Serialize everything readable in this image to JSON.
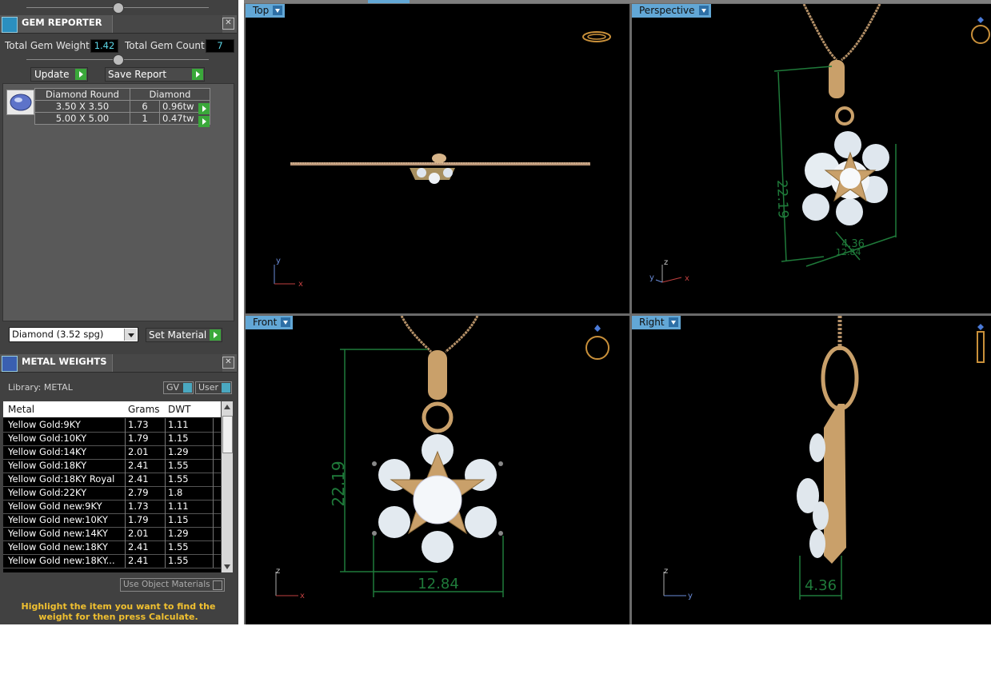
{
  "gem_reporter": {
    "title": "GEM REPORTER",
    "close": "✕",
    "total_weight_label": "Total Gem Weight",
    "total_weight_value": "1.42",
    "total_count_label": "Total Gem Count",
    "total_count_value": "7",
    "update_label": "Update",
    "save_report_label": "Save Report",
    "table": {
      "headers": [
        "Diamond Round",
        "Diamond"
      ],
      "rows": [
        {
          "size": "3.50 X 3.50",
          "count": "6",
          "weight": "0.96tw"
        },
        {
          "size": "5.00 X 5.00",
          "count": "1",
          "weight": "0.47tw"
        }
      ]
    },
    "material_select": "Diamond     (3.52 spg)",
    "set_material_label": "Set Material"
  },
  "metal_weights": {
    "title": "METAL WEIGHTS",
    "close": "✕",
    "library_label": "Library: METAL",
    "gv_label": "GV",
    "user_label": "User",
    "columns": [
      "Metal",
      "Grams",
      "DWT"
    ],
    "rows": [
      {
        "metal": "Yellow Gold:9KY",
        "grams": "1.73",
        "dwt": "1.11"
      },
      {
        "metal": "Yellow Gold:10KY",
        "grams": "1.79",
        "dwt": "1.15"
      },
      {
        "metal": "Yellow Gold:14KY",
        "grams": "2.01",
        "dwt": "1.29"
      },
      {
        "metal": "Yellow Gold:18KY",
        "grams": "2.41",
        "dwt": "1.55"
      },
      {
        "metal": "Yellow Gold:18KY Royal",
        "grams": "2.41",
        "dwt": "1.55"
      },
      {
        "metal": "Yellow Gold:22KY",
        "grams": "2.79",
        "dwt": "1.8"
      },
      {
        "metal": "Yellow Gold new:9KY",
        "grams": "1.73",
        "dwt": "1.11"
      },
      {
        "metal": "Yellow Gold new:10KY",
        "grams": "1.79",
        "dwt": "1.15"
      },
      {
        "metal": "Yellow Gold new:14KY",
        "grams": "2.01",
        "dwt": "1.29"
      },
      {
        "metal": "Yellow Gold new:18KY",
        "grams": "2.41",
        "dwt": "1.55"
      },
      {
        "metal": "Yellow Gold new:18KY...",
        "grams": "2.41",
        "dwt": "1.55"
      }
    ],
    "use_object_materials": "Use Object Materials",
    "hint": "Highlight the item you want to find the weight for then press Calculate."
  },
  "viewports": {
    "top": {
      "label": "Top",
      "axis1": "y",
      "axis2": "x"
    },
    "perspective": {
      "label": "Perspective",
      "dim_height": "22.19",
      "dim_width": "12.84",
      "dim_depth": "4.36",
      "axis1": "z",
      "axis2": "y",
      "axis3": "x"
    },
    "front": {
      "label": "Front",
      "dim_height": "22.19",
      "dim_width": "12.84",
      "axis1": "z",
      "axis2": "x"
    },
    "right": {
      "label": "Right",
      "dim_depth": "4.36",
      "axis1": "z",
      "axis2": "y"
    }
  },
  "colors": {
    "accent_tab": "#62a7d6",
    "dimension": "#1f7a3a",
    "gold": "#c9a06a",
    "hint": "#f0c030",
    "value_text": "#5cd6e6"
  }
}
